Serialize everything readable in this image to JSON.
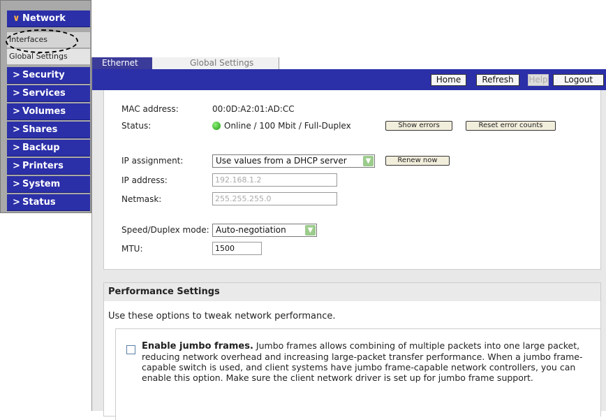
{
  "sidebar": {
    "network": {
      "label": "Network",
      "chevron": "v"
    },
    "sub_items": [
      {
        "label": "Interfaces"
      },
      {
        "label": "Global Settings"
      }
    ],
    "groups": [
      {
        "label": "Security",
        "chevron": ">"
      },
      {
        "label": "Services",
        "chevron": ">"
      },
      {
        "label": "Volumes",
        "chevron": ">"
      },
      {
        "label": "Shares",
        "chevron": ">"
      },
      {
        "label": "Backup",
        "chevron": ">"
      },
      {
        "label": "Printers",
        "chevron": ">"
      },
      {
        "label": "System",
        "chevron": ">"
      },
      {
        "label": "Status",
        "chevron": ">"
      }
    ]
  },
  "tabs": [
    {
      "label": "Ethernet",
      "active": true
    },
    {
      "label": "Global Settings",
      "active": false
    }
  ],
  "toolbar": {
    "home": "Home",
    "refresh": "Refresh",
    "help": "Help",
    "logout": "Logout"
  },
  "interface": {
    "mac_label": "MAC address:",
    "mac_value": "00:0D:A2:01:AD:CC",
    "status_label": "Status:",
    "status_value": "Online / 100 Mbit / Full-Duplex",
    "show_errors": "Show errors",
    "reset_errors": "Reset error counts",
    "ip_assignment_label": "IP assignment:",
    "ip_assignment_value": "Use values from a DHCP server",
    "renew_now": "Renew now",
    "ip_address_label": "IP address:",
    "ip_address_value": "192.168.1.2",
    "netmask_label": "Netmask:",
    "netmask_value": "255.255.255.0",
    "speed_label": "Speed/Duplex mode:",
    "speed_value": "Auto-negotiation",
    "mtu_label": "MTU:",
    "mtu_value": "1500"
  },
  "performance": {
    "title": "Performance Settings",
    "description": "Use these options to tweak network performance.",
    "jumbo_title": "Enable jumbo frames.",
    "jumbo_text": "Jumbo frames allows combining of multiple packets into one large packet, reducing network overhead and increasing large-packet transfer performance. When a jumbo frame-capable switch is used, and client systems have jumbo frame-capable network controllers, you can enable this option. Make sure the client network driver is set up for jumbo frame support.",
    "jumbo_checked": false
  },
  "colors": {
    "nav_blue": "#2b2fa8",
    "status_green": "#1e9a12"
  }
}
